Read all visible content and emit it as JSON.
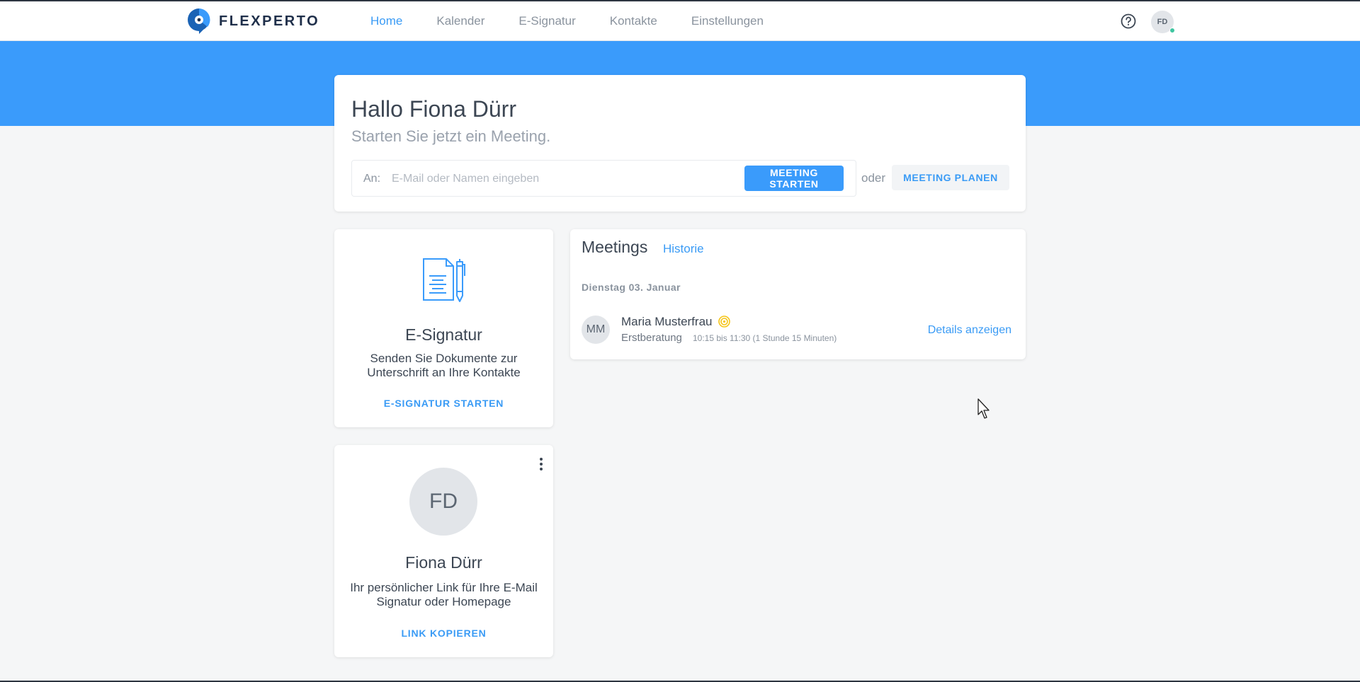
{
  "brand": {
    "name": "FLEXPERTO"
  },
  "nav": {
    "items": [
      {
        "label": "Home",
        "active": true
      },
      {
        "label": "Kalender"
      },
      {
        "label": "E-Signatur"
      },
      {
        "label": "Kontakte"
      },
      {
        "label": "Einstellungen"
      }
    ]
  },
  "user": {
    "initials": "FD"
  },
  "welcome": {
    "greeting": "Hallo Fiona Dürr",
    "subtitle": "Starten Sie jetzt ein Meeting.",
    "to_label": "An:",
    "input_placeholder": "E-Mail oder Namen eingeben",
    "input_value": "",
    "start_label": "MEETING STARTEN",
    "or_label": "oder",
    "plan_label": "MEETING PLANEN"
  },
  "esignatur": {
    "title": "E-Signatur",
    "desc_line1": "Senden Sie Dokumente zur",
    "desc_line2": "Unterschrift an Ihre Kontakte",
    "action": "E-SIGNATUR STARTEN"
  },
  "profile": {
    "initials": "FD",
    "name": "Fiona Dürr",
    "desc_line1": "Ihr persönlicher Link für Ihre E-Mail",
    "desc_line2": "Signatur oder Homepage",
    "action": "LINK KOPIEREN"
  },
  "meetings": {
    "title": "Meetings",
    "history_label": "Historie",
    "date_heading": "Dienstag 03. Januar",
    "items": [
      {
        "initials": "MM",
        "name": "Maria Musterfrau",
        "type": "Erstberatung",
        "time": "10:15 bis 11:30 (1 Stunde 15 Minuten)",
        "action": "Details anzeigen"
      }
    ]
  },
  "colors": {
    "accent": "#3a9bfb",
    "status_online": "#3ec5a0",
    "coin": "#f5c518"
  },
  "icons": [
    "help-icon",
    "document-pen-icon",
    "kebab-menu-icon",
    "coin-icon",
    "cursor-icon"
  ]
}
